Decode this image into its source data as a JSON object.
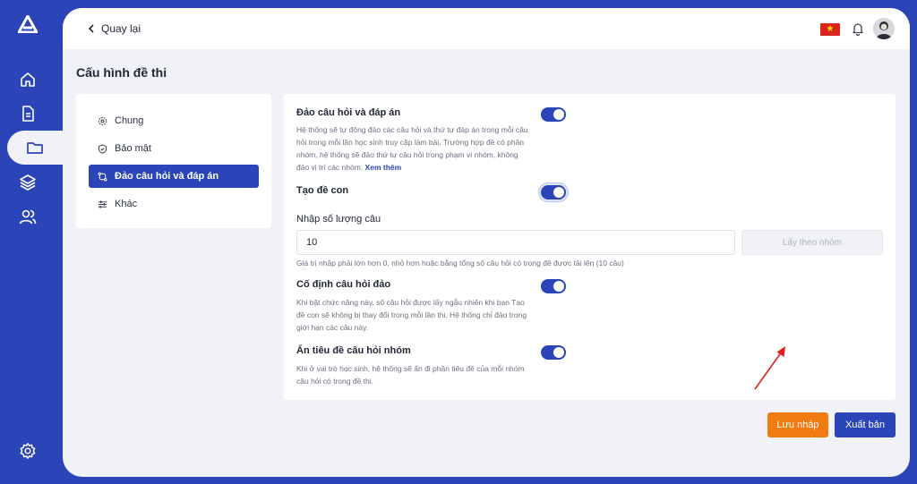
{
  "header": {
    "back_label": "Quay lại",
    "flag_star": "★"
  },
  "page": {
    "title": "Cấu hình đề thi"
  },
  "settings_nav": {
    "items": [
      {
        "label": "Chung",
        "icon": "gear-icon"
      },
      {
        "label": "Bảo mật",
        "icon": "shield-icon"
      },
      {
        "label": "Đảo câu hỏi và đáp án",
        "icon": "shuffle-icon",
        "active": true
      },
      {
        "label": "Khác",
        "icon": "sliders-icon"
      }
    ]
  },
  "sections": {
    "shuffle": {
      "title": "Đảo câu hỏi và đáp án",
      "description": "Hệ thống sẽ tự động đảo các câu hỏi và thứ tự đáp án trong mỗi câu hỏi trong mỗi lần học sinh truy cập làm bài. Trường hợp đề có phân nhóm, hệ thống sẽ đảo thứ tự câu hỏi trong phạm vi nhóm, không đảo vị trí các nhóm.",
      "link": "Xem thêm",
      "enabled": true
    },
    "subtest": {
      "title": "Tạo đề con",
      "enabled": true
    },
    "count": {
      "label": "Nhập số lượng câu",
      "value": "10",
      "button_label": "Lấy theo nhóm",
      "hint": "Giá trị nhập phải lớn hơn 0, nhỏ hơn hoặc bằng tổng số câu hỏi có trong đề được tải lên (10 câu)"
    },
    "fixed": {
      "title": "Cố định câu hỏi đảo",
      "description": "Khi bật chức năng này, số câu hỏi được lấy ngẫu nhiên khi bạn Tạo đề con sẽ không bị thay đổi trong mỗi lần thi. Hệ thống chỉ đảo trong giới hạn các câu này.",
      "enabled": true
    },
    "hide_group_title": {
      "title": "Ẩn tiêu đề câu hỏi nhóm",
      "description": "Khi ở vai trò học sinh, hệ thống sẽ ẩn đi phần tiêu đề của mỗi nhóm câu hỏi có trong đề thi.",
      "enabled": true
    }
  },
  "footer": {
    "draft_label": "Lưu nháp",
    "publish_label": "Xuất bản"
  },
  "colors": {
    "primary": "#2b45b8",
    "draft": "#f07b10",
    "annotation_arrow": "#e02020"
  }
}
